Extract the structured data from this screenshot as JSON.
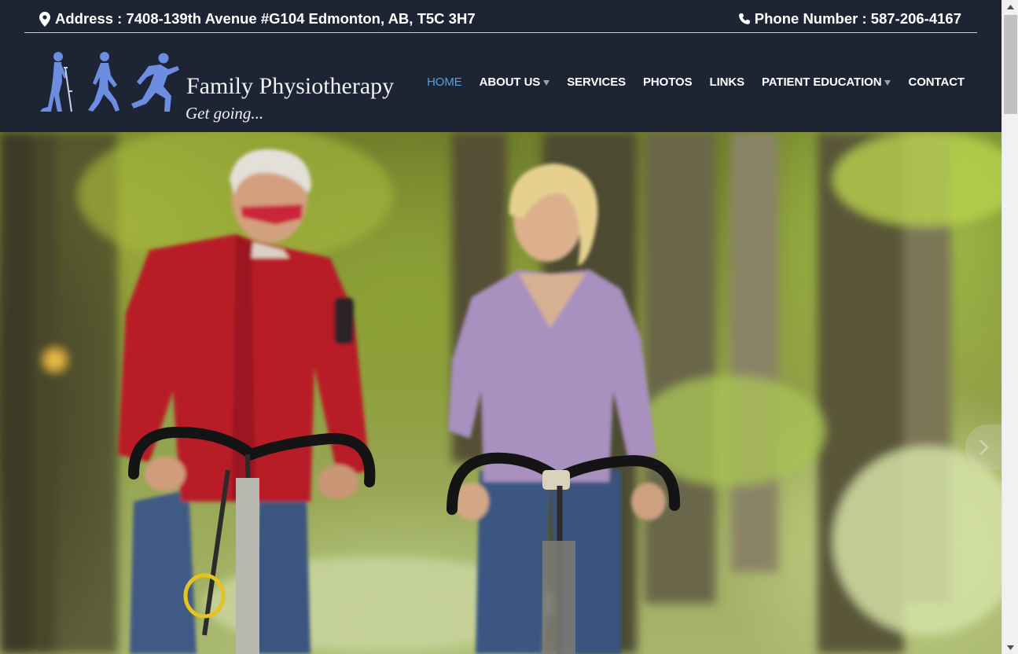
{
  "topbar": {
    "address": "Address : 7408-139th Avenue #G104 Edmonton, AB, T5C 3H7",
    "address_icon": "map-marker-icon",
    "phone": "Phone Number : 587-206-4167",
    "phone_icon": "phone-icon"
  },
  "logo": {
    "title": "Family Physiotherapy",
    "tagline": "Get going...",
    "figures_icon": "walking-figures-logo",
    "color": "#6d8ee0"
  },
  "nav": {
    "items": [
      {
        "label": "HOME",
        "active": true,
        "dropdown": false
      },
      {
        "label": "ABOUT US",
        "active": false,
        "dropdown": true
      },
      {
        "label": "SERVICES",
        "active": false,
        "dropdown": false
      },
      {
        "label": "PHOTOS",
        "active": false,
        "dropdown": false
      },
      {
        "label": "LINKS",
        "active": false,
        "dropdown": false
      },
      {
        "label": "PATIENT EDUCATION",
        "active": false,
        "dropdown": true
      },
      {
        "label": "CONTACT",
        "active": false,
        "dropdown": false
      }
    ]
  },
  "colors": {
    "header_bg": "#1d2433",
    "active_link": "#4fa3e3",
    "link": "#ffffff"
  },
  "hero": {
    "image": "couple-cycling-in-forest-photo",
    "next_icon": "chevron-right-icon"
  }
}
